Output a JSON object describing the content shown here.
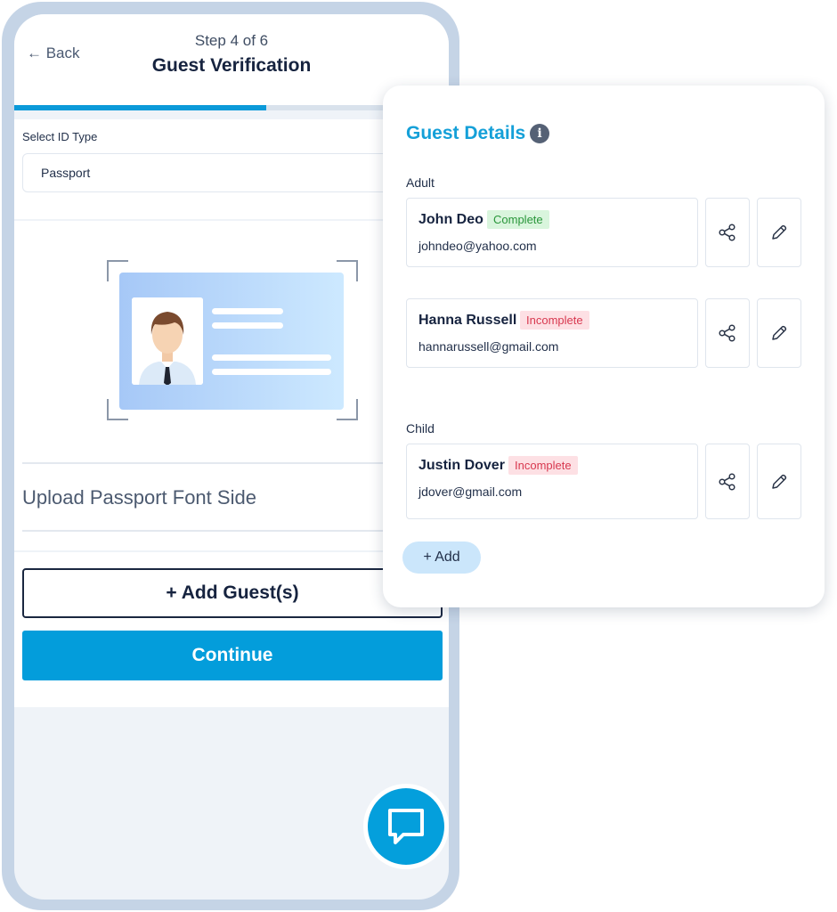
{
  "header": {
    "back_label": "← Back",
    "step_label": "Step 4 of 6",
    "title": "Guest Verification",
    "progress": 0.58
  },
  "id_type": {
    "label": "Select ID Type",
    "value": "Passport"
  },
  "upload": {
    "label": "Upload Passport Font Side"
  },
  "actions": {
    "add_guests_label": "+ Add Guest(s)",
    "continue_label": "Continue"
  },
  "colors": {
    "accent": "#039ddb",
    "complete": "#29963a",
    "incomplete": "#d8384f"
  },
  "guest_panel": {
    "title": "Guest Details",
    "groups": [
      {
        "label": "Adult",
        "guests": [
          {
            "name": "John Deo",
            "status": "Complete",
            "email": "johndeo@yahoo.com"
          },
          {
            "name": "Hanna Russell",
            "status": "Incomplete",
            "email": "hannarussell@gmail.com"
          }
        ]
      },
      {
        "label": "Child",
        "guests": [
          {
            "name": "Justin Dover",
            "status": "Incomplete",
            "email": "jdover@gmail.com"
          }
        ]
      }
    ],
    "add_label": "+ Add"
  },
  "icons": [
    "back-arrow",
    "info-icon",
    "share-icon",
    "edit-icon",
    "chat-icon"
  ]
}
